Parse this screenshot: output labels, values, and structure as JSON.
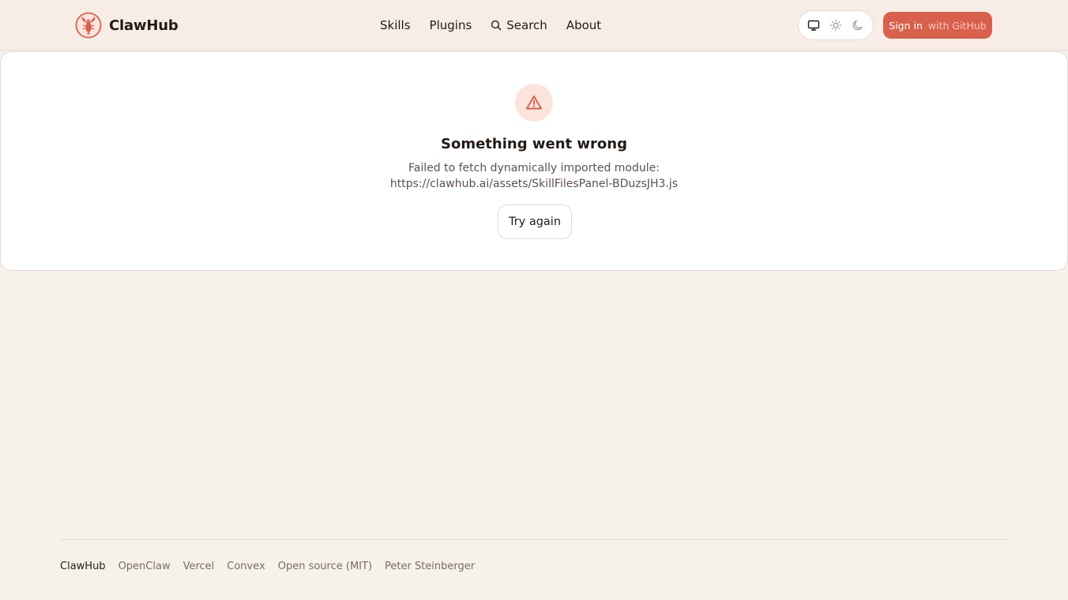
{
  "header": {
    "brand_name": "ClawHub",
    "nav": {
      "skills": "Skills",
      "plugins": "Plugins",
      "search": "Search",
      "about": "About"
    },
    "theme_options": [
      "system-monitor-icon",
      "sun-icon",
      "moon-icon"
    ],
    "signin": {
      "label": "Sign in",
      "sub_label": "with GitHub"
    }
  },
  "error": {
    "icon": "warning-triangle-icon",
    "title": "Something went wrong",
    "message_line1": "Failed to fetch dynamically imported module:",
    "message_line2": "https://clawhub.ai/assets/SkillFilesPanel-BDuzsJH3.js",
    "retry_label": "Try again"
  },
  "footer": {
    "items": [
      "ClawHub",
      "OpenClaw",
      "Vercel",
      "Convex",
      "Open source (MIT)",
      "Peter Steinberger"
    ]
  },
  "colors": {
    "accent": "#d9604b",
    "page_background": "#f7f1ec",
    "header_background": "#f8ede6",
    "card_background": "#ffffff",
    "border": "#e6d9d1",
    "alert_circle_background": "#fbe4dc",
    "text_primary": "#231a16",
    "text_muted": "#7a6b64"
  }
}
